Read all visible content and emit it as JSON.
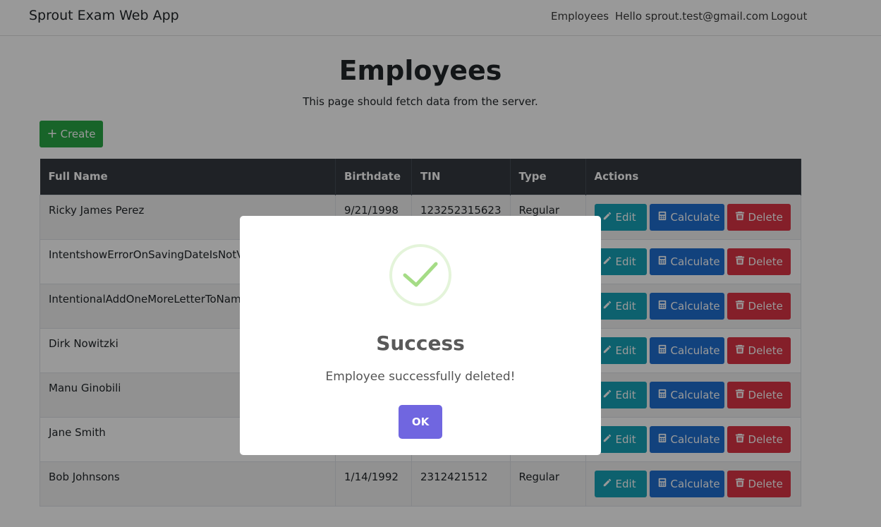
{
  "navbar": {
    "brand": "Sprout Exam Web App",
    "links": [
      "Employees",
      "Hello sprout.test@gmail.com",
      "Logout"
    ]
  },
  "page": {
    "title": "Employees",
    "subtitle": "This page should fetch data from the server.",
    "create_label": "Create"
  },
  "table": {
    "headers": [
      "Full Name",
      "Birthdate",
      "TIN",
      "Type",
      "Actions"
    ],
    "rows": [
      {
        "name": "Ricky James Perez",
        "birthdate": "9/21/1998",
        "tin": "123252315623",
        "type": "Regular"
      },
      {
        "name": "IntentshowErrorOnSavingDateIsNotVal",
        "birthdate": "",
        "tin": "",
        "type": ""
      },
      {
        "name": "IntentionalAddOneMoreLetterToName",
        "birthdate": "",
        "tin": "",
        "type": ""
      },
      {
        "name": "Dirk Nowitzki",
        "birthdate": "",
        "tin": "",
        "type": ""
      },
      {
        "name": "Manu Ginobili",
        "birthdate": "",
        "tin": "",
        "type": ""
      },
      {
        "name": "Jane Smith",
        "birthdate": "",
        "tin": "",
        "type": ""
      },
      {
        "name": "Bob Johnsons",
        "birthdate": "1/14/1992",
        "tin": "2312421512",
        "type": "Regular"
      }
    ],
    "action_labels": {
      "edit": "Edit",
      "calculate": "Calculate",
      "delete": "Delete"
    }
  },
  "modal": {
    "icon": "success-check-icon",
    "title": "Success",
    "text": "Employee successfully deleted!",
    "ok_label": "OK"
  },
  "colors": {
    "create": "#28a745",
    "edit": "#17a2b8",
    "calculate": "#1f6fd1",
    "delete": "#dc3545",
    "ok": "#7066e0",
    "check": "#a5dc86"
  }
}
